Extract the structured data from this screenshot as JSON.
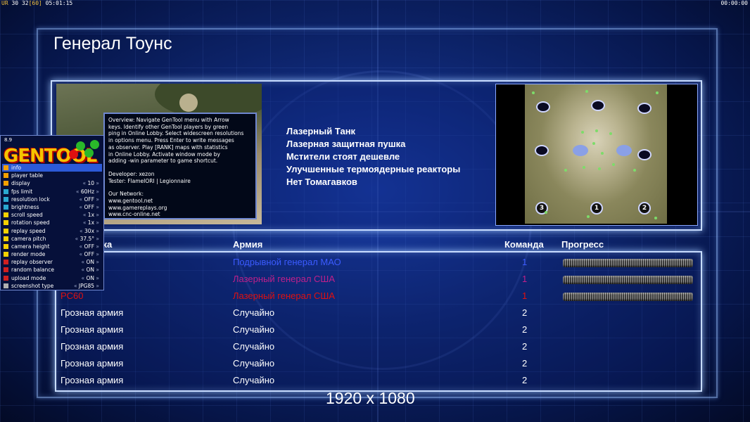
{
  "topbar": {
    "label": "UR",
    "fps": "30",
    "fps_limit": "32",
    "fps_max": "[60]",
    "timer": "05:01:15",
    "clock": "00:00:00"
  },
  "lobby": {
    "title": "Генерал Тоунс",
    "rules": [
      "Лазерный Танк",
      "Лазерная защитная пушка",
      "Мстители стоят дешевле",
      "Улучшенные термоядерные реакторы",
      "Нет Томагавков"
    ],
    "map": {
      "start_positions": [
        "3",
        "1",
        "2"
      ]
    },
    "table": {
      "headers": [
        "Имя игрока",
        "Армия",
        "Команда",
        "Прогресс"
      ],
      "rows": [
        {
          "name": "",
          "army": "Подрывной генерал МАО",
          "team": "1",
          "color": "#3b5bff",
          "progress": 1.0
        },
        {
          "name": "",
          "army": "Лазерный генерал США",
          "team": "1",
          "color": "#c0208a",
          "progress": 1.0
        },
        {
          "name": "PC60",
          "army": "Лазерный генерал США",
          "team": "1",
          "color": "#e01010",
          "progress": 1.0
        },
        {
          "name": "Грозная армия",
          "army": "Случайно",
          "team": "2",
          "color": "#ffffff"
        },
        {
          "name": "Грозная армия",
          "army": "Случайно",
          "team": "2",
          "color": "#ffffff"
        },
        {
          "name": "Грозная армия",
          "army": "Случайно",
          "team": "2",
          "color": "#ffffff"
        },
        {
          "name": "Грозная армия",
          "army": "Случайно",
          "team": "2",
          "color": "#ffffff"
        },
        {
          "name": "Грозная армия",
          "army": "Случайно",
          "team": "2",
          "color": "#ffffff"
        }
      ]
    },
    "resolution": "1920 x 1080"
  },
  "gentool": {
    "version": "8.9",
    "logo": "GENTOOL",
    "items": [
      {
        "label": "info",
        "value": "",
        "color": "#f5a000",
        "active": true
      },
      {
        "label": "player table",
        "value": "",
        "color": "#f5a000"
      },
      {
        "label": "display",
        "value": "10",
        "color": "#f5a000"
      },
      {
        "label": "fps limit",
        "value": "60Hz",
        "color": "#2aa8d0"
      },
      {
        "label": "resolution lock",
        "value": "OFF",
        "color": "#2aa8d0"
      },
      {
        "label": "brightness",
        "value": "OFF",
        "color": "#2aa8d0"
      },
      {
        "label": "scroll speed",
        "value": "1x",
        "color": "#f5d000"
      },
      {
        "label": "rotation speed",
        "value": "1x",
        "color": "#f5d000"
      },
      {
        "label": "replay speed",
        "value": "30x",
        "color": "#f5d000"
      },
      {
        "label": "camera pitch",
        "value": "37.5°",
        "color": "#f5d000"
      },
      {
        "label": "camera height",
        "value": "OFF",
        "color": "#f5d000"
      },
      {
        "label": "render mode",
        "value": "OFF",
        "color": "#f5d000"
      },
      {
        "label": "replay observer",
        "value": "ON",
        "color": "#d02020"
      },
      {
        "label": "random balance",
        "value": "ON",
        "color": "#d02020"
      },
      {
        "label": "upload mode",
        "value": "ON",
        "color": "#d02020"
      },
      {
        "label": "screenshot type",
        "value": "JPG85",
        "color": "#b0b0b0"
      }
    ],
    "tooltip": {
      "lines": [
        "Overview: Navigate GenTool menu with Arrow",
        "keys. Identify other GenTool players by green",
        "ping in Online Lobby. Select widescreen resolutions",
        "in options menu. Press Enter to write messages",
        "as observer. Play [RANK] maps with statistics",
        "in Online Lobby. Activate window mode by",
        "adding -win parameter to game shortcut."
      ],
      "developer": "Developer: xezon",
      "tester": "Tester: FlameIORI | Legionnaire",
      "network_title": "Our Network:",
      "links": [
        "www.gentool.net",
        "www.gamereplays.org",
        "www.cnc-online.net"
      ]
    }
  }
}
